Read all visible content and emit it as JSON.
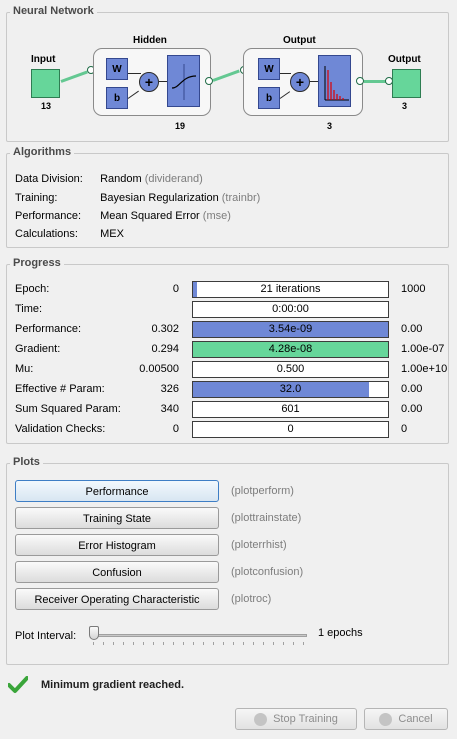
{
  "network": {
    "section_title": "Neural Network",
    "input_label": "Input",
    "input_size": "13",
    "hidden_title": "Hidden",
    "hidden_size": "19",
    "output_layer_title": "Output",
    "output_layer_size": "3",
    "output_label": "Output",
    "output_size": "3",
    "weight_label": "W",
    "bias_label": "b",
    "plus": "+"
  },
  "algorithms": {
    "section_title": "Algorithms",
    "rows": [
      {
        "label": "Data Division:",
        "value": "Random",
        "fn": "(dividerand)"
      },
      {
        "label": "Training:",
        "value": "Bayesian Regularization",
        "fn": "(trainbr)"
      },
      {
        "label": "Performance:",
        "value": "Mean Squared Error",
        "fn": "(mse)"
      },
      {
        "label": "Calculations:",
        "value": "MEX",
        "fn": ""
      }
    ]
  },
  "progress": {
    "section_title": "Progress",
    "rows": [
      {
        "label": "Epoch:",
        "start": "0",
        "bar_text": "21 iterations",
        "end": "1000",
        "fill": 0.02,
        "color": "#6f88d6"
      },
      {
        "label": "Time:",
        "start": "",
        "bar_text": "0:00:00",
        "end": "",
        "fill": 0,
        "color": "#6f88d6"
      },
      {
        "label": "Performance:",
        "start": "0.302",
        "bar_text": "3.54e-09",
        "end": "0.00",
        "fill": 1.0,
        "color": "#6f88d6"
      },
      {
        "label": "Gradient:",
        "start": "0.294",
        "bar_text": "4.28e-08",
        "end": "1.00e-07",
        "fill": 1.0,
        "color": "#66d69a"
      },
      {
        "label": "Mu:",
        "start": "0.00500",
        "bar_text": "0.500",
        "end": "1.00e+10",
        "fill": 0,
        "color": "#6f88d6"
      },
      {
        "label": "Effective # Param:",
        "start": "326",
        "bar_text": "32.0",
        "end": "0.00",
        "fill": 0.9,
        "color": "#6f88d6"
      },
      {
        "label": "Sum Squared Param:",
        "start": "340",
        "bar_text": "601",
        "end": "0.00",
        "fill": 0,
        "color": "#6f88d6"
      },
      {
        "label": "Validation Checks:",
        "start": "0",
        "bar_text": "0",
        "end": "0",
        "fill": 0,
        "color": "#6f88d6"
      }
    ]
  },
  "plots": {
    "section_title": "Plots",
    "buttons": [
      {
        "label": "Performance",
        "fn": "(plotperform)"
      },
      {
        "label": "Training State",
        "fn": "(plottrainstate)"
      },
      {
        "label": "Error Histogram",
        "fn": "(ploterrhist)"
      },
      {
        "label": "Confusion",
        "fn": "(plotconfusion)"
      },
      {
        "label": "Receiver Operating Characteristic",
        "fn": "(plotroc)"
      }
    ],
    "interval_label": "Plot Interval:",
    "interval_value": "1 epochs"
  },
  "status": {
    "message": "Minimum gradient reached.",
    "icon": "checkmark-icon"
  },
  "footer": {
    "stop_label": "Stop Training",
    "cancel_label": "Cancel"
  },
  "colors": {
    "blue": "#6f88d6",
    "green": "#66d69a"
  }
}
